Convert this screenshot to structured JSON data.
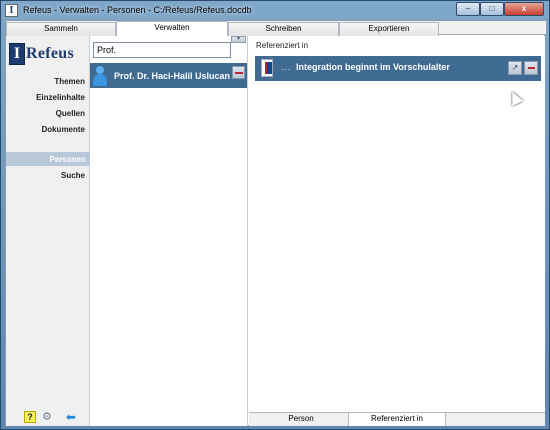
{
  "window": {
    "title": "Refeus - Verwalten - Personen - C:/Refeus/Refeus.docdb",
    "app_icon": "I",
    "min_label": "–",
    "max_label": "□",
    "close_label": "x"
  },
  "tabs": [
    {
      "label": "Sammeln"
    },
    {
      "label": "Verwalten"
    },
    {
      "label": "Schreiben"
    },
    {
      "label": "Exportieren"
    }
  ],
  "logo": {
    "box": "I",
    "text": "Refeus"
  },
  "nav": {
    "items": [
      "Themen",
      "Einzelinhalte",
      "Quellen",
      "Dokumente",
      "Personen",
      "Suche"
    ],
    "selected": "Personen"
  },
  "search": {
    "value": "Prof."
  },
  "persons": [
    {
      "name": "Prof. Dr. Haci-Halil Uslucan"
    }
  ],
  "right_panel": {
    "label": "Referenziert in",
    "references": [
      {
        "title": "Integration beginnt im Vorschulalter"
      }
    ]
  },
  "bottom_tabs": [
    {
      "label": "Person"
    },
    {
      "label": "Referenziert in"
    }
  ],
  "icons": {
    "help": "?",
    "gear": "⚙",
    "back": "⬅",
    "type": "…",
    "go": "↗",
    "dropdown": "▾"
  }
}
